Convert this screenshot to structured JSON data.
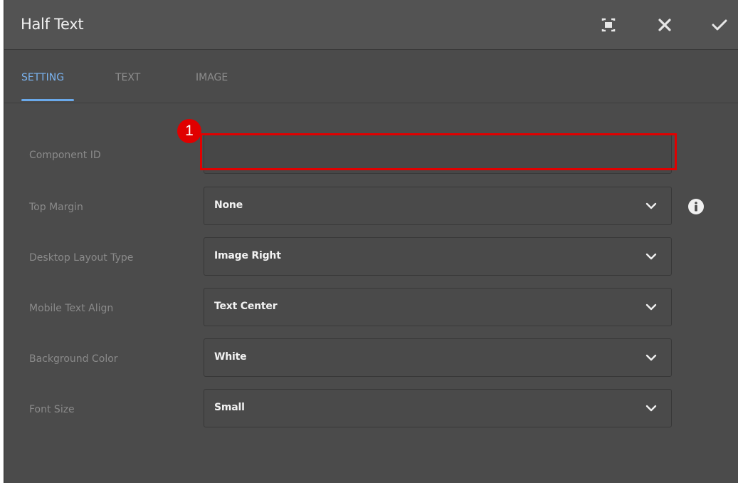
{
  "dialog": {
    "title": "Half Text",
    "actions": {
      "fullscreen_icon": "fullscreen-icon",
      "close_icon": "close-icon",
      "confirm_icon": "checkmark-icon"
    }
  },
  "tabs": [
    {
      "label": "SETTING",
      "active": true
    },
    {
      "label": "TEXT",
      "active": false
    },
    {
      "label": "IMAGE",
      "active": false
    }
  ],
  "form": {
    "component_id": {
      "label": "Component ID",
      "value": "",
      "placeholder": ""
    },
    "top_margin": {
      "label": "Top Margin",
      "value": "None"
    },
    "desktop_layout_type": {
      "label": "Desktop Layout Type",
      "value": "Image Right"
    },
    "mobile_text_align": {
      "label": "Mobile Text Align",
      "value": "Text Center"
    },
    "background_color": {
      "label": "Background Color",
      "value": "White"
    },
    "font_size": {
      "label": "Font Size",
      "value": "Small"
    }
  },
  "annotation": {
    "badge": "1",
    "color": "#e00000"
  },
  "colors": {
    "dialog_bg": "#4b4b4b",
    "titlebar_bg": "#535353",
    "active_tab": "#7ab3ef"
  }
}
